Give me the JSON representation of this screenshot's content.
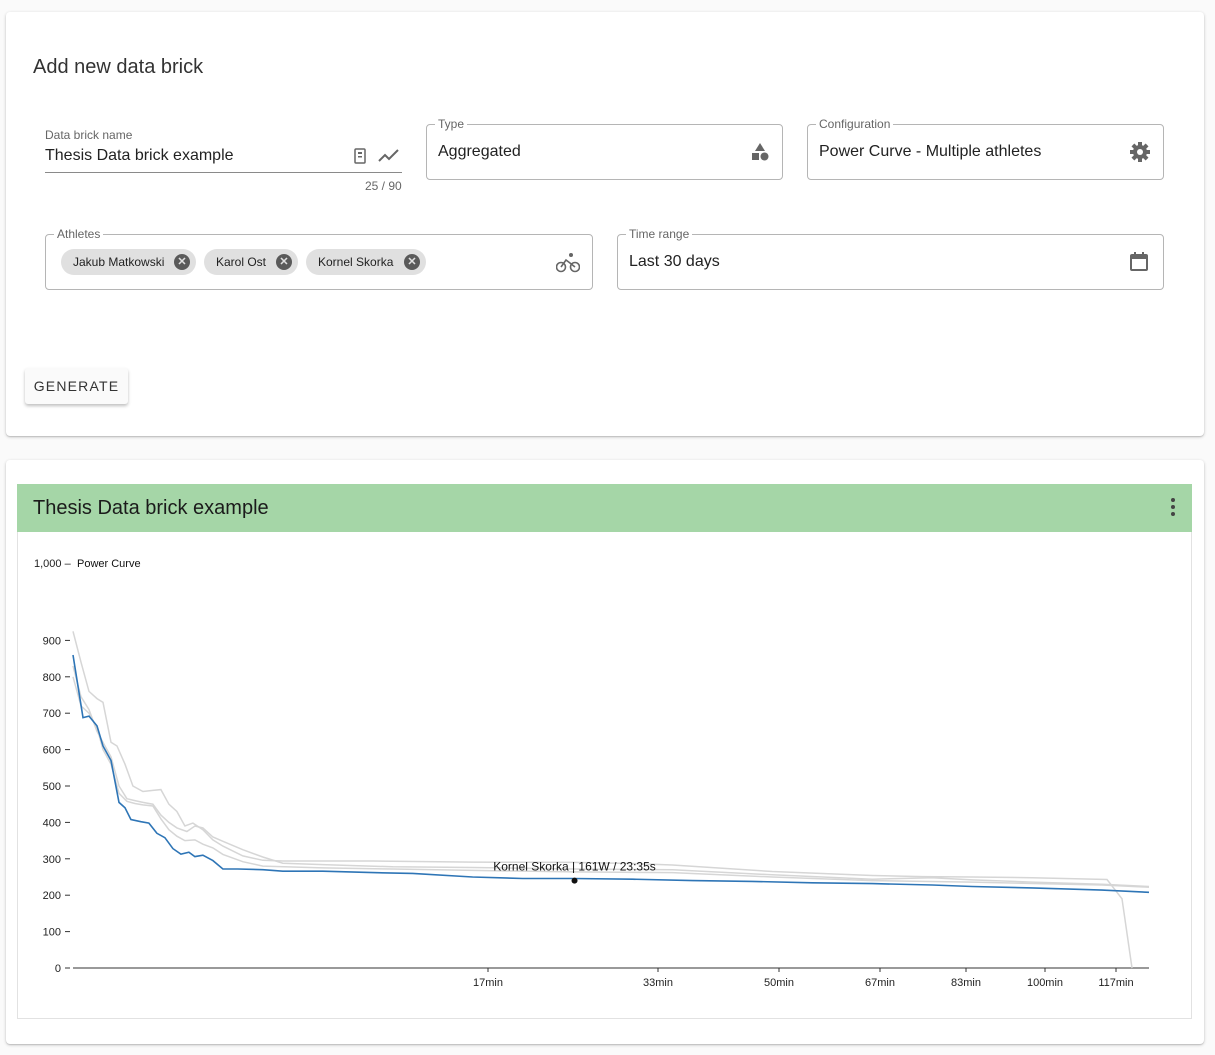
{
  "form": {
    "title": "Add new data brick",
    "name_field": {
      "label": "Data brick name",
      "value": "Thesis Data brick example",
      "counter": "25 / 90",
      "icons": [
        "clipboard-icon",
        "trending-icon"
      ]
    },
    "type_field": {
      "label": "Type",
      "value": "Aggregated",
      "icon": "shapes-icon"
    },
    "config_field": {
      "label": "Configuration",
      "value": "Power Curve - Multiple athletes",
      "icon": "gear-icon"
    },
    "athletes_field": {
      "label": "Athletes",
      "chips": [
        "Jakub Matkowski",
        "Karol Ost",
        "Kornel Skorka"
      ],
      "icon": "bike-icon"
    },
    "time_field": {
      "label": "Time range",
      "value": "Last 30 days",
      "icon": "calendar-icon"
    },
    "generate_label": "GENERATE"
  },
  "result": {
    "title": "Thesis Data brick example",
    "header_color": "#a5d6a7",
    "menu_icon": "kebab-icon"
  },
  "chart_data": {
    "type": "line",
    "title": "Power Curve",
    "y_ticks": [
      "0",
      "100",
      "200",
      "300",
      "400",
      "500",
      "600",
      "700",
      "800",
      "900",
      "1,000"
    ],
    "ylim": [
      0,
      1000
    ],
    "x_ticks": [
      "17min",
      "33min",
      "50min",
      "67min",
      "83min",
      "100min",
      "117min"
    ],
    "tooltip": "Kornel Skorka | 161W / 23:35s",
    "highlight_color": "#2e75b6",
    "other_color": "#d6d6d6",
    "series": [
      {
        "highlight": true,
        "points": [
          [
            0,
            860
          ],
          [
            10,
            688
          ],
          [
            16,
            692
          ],
          [
            24,
            665
          ],
          [
            30,
            610
          ],
          [
            38,
            570
          ],
          [
            46,
            455
          ],
          [
            52,
            440
          ],
          [
            58,
            408
          ],
          [
            68,
            402
          ],
          [
            76,
            398
          ],
          [
            84,
            370
          ],
          [
            92,
            358
          ],
          [
            100,
            328
          ],
          [
            108,
            313
          ],
          [
            116,
            318
          ],
          [
            122,
            306
          ],
          [
            130,
            310
          ],
          [
            140,
            295
          ],
          [
            150,
            272
          ],
          [
            165,
            272
          ],
          [
            190,
            270
          ],
          [
            210,
            266
          ],
          [
            250,
            266
          ],
          [
            300,
            262
          ],
          [
            340,
            260
          ],
          [
            400,
            250
          ],
          [
            450,
            246
          ],
          [
            500,
            246
          ],
          [
            560,
            244
          ],
          [
            620,
            240
          ],
          [
            680,
            238
          ],
          [
            740,
            234
          ],
          [
            800,
            232
          ],
          [
            860,
            228
          ],
          [
            900,
            224
          ],
          [
            960,
            220
          ],
          [
            1030,
            214
          ],
          [
            1077,
            208
          ]
        ]
      },
      {
        "highlight": false,
        "points": [
          [
            0,
            925
          ],
          [
            8,
            840
          ],
          [
            16,
            760
          ],
          [
            24,
            740
          ],
          [
            30,
            730
          ],
          [
            38,
            620
          ],
          [
            44,
            610
          ],
          [
            52,
            560
          ],
          [
            60,
            500
          ],
          [
            70,
            485
          ],
          [
            80,
            488
          ],
          [
            88,
            490
          ],
          [
            96,
            450
          ],
          [
            104,
            430
          ],
          [
            112,
            390
          ],
          [
            120,
            398
          ],
          [
            130,
            380
          ],
          [
            140,
            352
          ],
          [
            150,
            335
          ],
          [
            170,
            308
          ],
          [
            190,
            296
          ],
          [
            210,
            294
          ],
          [
            300,
            294
          ],
          [
            400,
            291
          ],
          [
            500,
            290
          ],
          [
            560,
            287
          ],
          [
            600,
            283
          ],
          [
            700,
            265
          ],
          [
            800,
            254
          ],
          [
            850,
            251
          ],
          [
            900,
            250
          ],
          [
            960,
            248
          ],
          [
            1035,
            243
          ],
          [
            1050,
            190
          ],
          [
            1060,
            0
          ]
        ]
      },
      {
        "highlight": false,
        "points": [
          [
            0,
            830
          ],
          [
            8,
            745
          ],
          [
            16,
            710
          ],
          [
            24,
            650
          ],
          [
            30,
            620
          ],
          [
            38,
            580
          ],
          [
            46,
            500
          ],
          [
            54,
            465
          ],
          [
            62,
            460
          ],
          [
            70,
            455
          ],
          [
            80,
            450
          ],
          [
            88,
            420
          ],
          [
            96,
            400
          ],
          [
            104,
            385
          ],
          [
            114,
            375
          ],
          [
            122,
            390
          ],
          [
            130,
            385
          ],
          [
            140,
            360
          ],
          [
            150,
            348
          ],
          [
            170,
            325
          ],
          [
            190,
            305
          ],
          [
            210,
            288
          ],
          [
            250,
            284
          ],
          [
            320,
            278
          ],
          [
            400,
            276
          ],
          [
            500,
            272
          ],
          [
            600,
            270
          ],
          [
            700,
            256
          ],
          [
            800,
            244
          ],
          [
            860,
            248
          ],
          [
            900,
            242
          ],
          [
            960,
            236
          ],
          [
            1030,
            230
          ],
          [
            1077,
            224
          ]
        ]
      },
      {
        "highlight": false,
        "points": [
          [
            0,
            800
          ],
          [
            8,
            720
          ],
          [
            16,
            700
          ],
          [
            24,
            660
          ],
          [
            30,
            600
          ],
          [
            38,
            560
          ],
          [
            46,
            480
          ],
          [
            54,
            458
          ],
          [
            62,
            452
          ],
          [
            70,
            448
          ],
          [
            80,
            445
          ],
          [
            88,
            410
          ],
          [
            96,
            380
          ],
          [
            104,
            362
          ],
          [
            112,
            350
          ],
          [
            122,
            352
          ],
          [
            130,
            340
          ],
          [
            140,
            330
          ],
          [
            150,
            312
          ],
          [
            170,
            292
          ],
          [
            190,
            280
          ],
          [
            250,
            275
          ],
          [
            320,
            272
          ],
          [
            400,
            268
          ],
          [
            500,
            264
          ],
          [
            600,
            262
          ],
          [
            700,
            250
          ],
          [
            800,
            240
          ],
          [
            900,
            236
          ],
          [
            1030,
            228
          ],
          [
            1077,
            222
          ]
        ]
      }
    ],
    "x_range": [
      0,
      1077
    ],
    "tooltip_x": 502,
    "tooltip_y": 240
  }
}
